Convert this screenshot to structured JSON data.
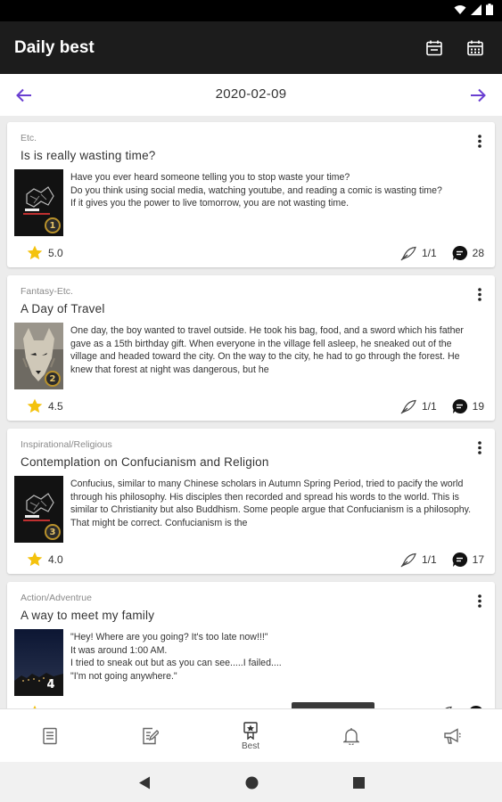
{
  "app_title": "Daily best",
  "date": "2020-02-09",
  "colors": {
    "accent": "#6a3fd1",
    "star": "#f4c20d",
    "appbar": "#1c1c1c"
  },
  "cards": [
    {
      "genre": "Etc.",
      "title": "Is is really wasting time?",
      "excerpt": [
        "Have you ever heard someone telling you to stop waste your time?",
        "Do you think using social media, watching youtube, and reading a comic is wasting time?",
        "If it gives you the power to live tomorrow, you are not wasting time."
      ],
      "rank": "1",
      "rating": "5.0",
      "episodes": "1/1",
      "comments": "28"
    },
    {
      "genre": "Fantasy-Etc.",
      "title": "A Day of Travel",
      "excerpt": [
        "One day, the boy wanted to travel outside. He took his bag, food, and a sword which his father gave as a 15th birthday gift. When everyone in the village fell asleep, he sneaked out of the village and headed toward the city. On the way to the city, he had to go through the forest. He knew that forest at night was dangerous, but he"
      ],
      "rank": "2",
      "rating": "4.5",
      "episodes": "1/1",
      "comments": "19"
    },
    {
      "genre": "Inspirational/Religious",
      "title": "Contemplation on Confucianism and Religion",
      "excerpt": [
        "Confucius, similar to many Chinese scholars in Autumn Spring Period, tried to pacify the world through his philosophy. His disciples then recorded and spread his words to the world. This is similar to Christianity but also Buddhism. Some people argue that Confucianism is a philosophy. That might be correct. Confucianism is the"
      ],
      "rank": "3",
      "rating": "4.0",
      "episodes": "1/1",
      "comments": "17"
    },
    {
      "genre": "Action/Adventrue",
      "title": "A way to meet my family",
      "excerpt": [
        "\"Hey! Where are you going? It's too late now!!!\"",
        "It was around 1:00 AM.",
        "I tried to sneak out but as you can see.....I failed....",
        "\"I'm not going anywhere.\""
      ],
      "rank": "4",
      "rating": "",
      "episodes": "",
      "comments": ""
    }
  ],
  "bottom_nav": [
    {
      "icon": "document-icon",
      "label": ""
    },
    {
      "icon": "edit-document-icon",
      "label": ""
    },
    {
      "icon": "best-medal-icon",
      "label": "Best"
    },
    {
      "icon": "bell-icon",
      "label": ""
    },
    {
      "icon": "megaphone-icon",
      "label": ""
    }
  ]
}
